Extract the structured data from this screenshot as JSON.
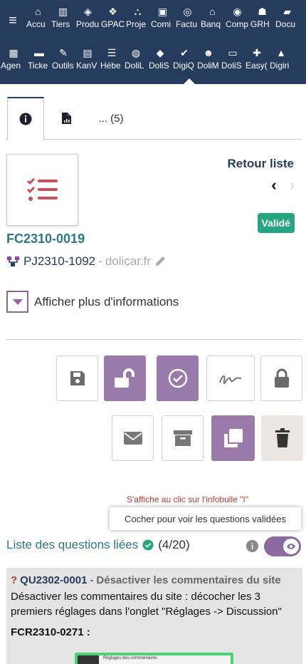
{
  "nav": {
    "row1": [
      {
        "icon": "home-icon",
        "glyph": "⌂",
        "label": "Accu"
      },
      {
        "icon": "building-icon",
        "glyph": "▥",
        "label": "Tiers"
      },
      {
        "icon": "cube-icon",
        "glyph": "◈",
        "label": "Produ"
      },
      {
        "icon": "cubes-icon",
        "glyph": "❖",
        "label": "GPAC"
      },
      {
        "icon": "project-icon",
        "glyph": "⛬",
        "label": "Proje"
      },
      {
        "icon": "briefcase-icon",
        "glyph": "▣",
        "label": "Comi"
      },
      {
        "icon": "coins-icon",
        "glyph": "◎",
        "label": "Factu"
      },
      {
        "icon": "bank-icon",
        "glyph": "⌂",
        "label": "Banq"
      },
      {
        "icon": "search-dollar-icon",
        "glyph": "◉",
        "label": "Comp"
      },
      {
        "icon": "user-tie-icon",
        "glyph": "☗",
        "label": "GRH"
      },
      {
        "icon": "folder-open-icon",
        "glyph": "▰",
        "label": "Docu"
      }
    ],
    "row2": [
      {
        "icon": "calendar-icon",
        "glyph": "▦",
        "label": "Agen"
      },
      {
        "icon": "ticket-icon",
        "glyph": "▬",
        "label": "Ticke"
      },
      {
        "icon": "wrench-icon",
        "glyph": "✎",
        "label": "Outils"
      },
      {
        "icon": "kanban-icon",
        "glyph": "▤",
        "label": "KanV"
      },
      {
        "icon": "server-icon",
        "glyph": "☰",
        "label": "Hébe"
      },
      {
        "icon": "dolil-icon",
        "glyph": "◍",
        "label": "DoliL"
      },
      {
        "icon": "lock-icon",
        "glyph": "◆",
        "label": "DoliS"
      },
      {
        "icon": "clipboard-check-icon",
        "glyph": "✔",
        "label": "DigiQ"
      },
      {
        "icon": "users-icon",
        "glyph": "☻",
        "label": "DoliM"
      },
      {
        "icon": "id-card-icon",
        "glyph": "▭",
        "label": "DoliS"
      },
      {
        "icon": "easy-icon",
        "glyph": "✚",
        "label": "Easy("
      },
      {
        "icon": "digiri-icon",
        "glyph": "▲",
        "label": "Digiri"
      }
    ]
  },
  "tabs": {
    "more_label": "... (5)"
  },
  "record": {
    "ref": "FC2310-0019",
    "project_ref": "PJ2310-1092",
    "project_separator": " - ",
    "project_site": "dolicar.fr",
    "back_label": "Retour liste",
    "prev_glyph": "‹",
    "next_glyph": "›",
    "status": "Validé",
    "more_info": "Afficher plus d'informations"
  },
  "tooltip": {
    "note": "S'affiche au clic sur l'infobulle \"I\"",
    "text": "Cocher pour voir les questions validées"
  },
  "questions": {
    "title": "Liste des questions liées",
    "count": "(4/20)",
    "info_glyph": "i",
    "item": {
      "code": "QU2302-0001",
      "sep": " - ",
      "label": "Désactiver les commentaires du site",
      "text": "Désactiver les commentaires du site : décocher les 3 premiers réglages dans l'onglet \"Réglages -> Discussion\"",
      "sub": "FCR2310-0271 :",
      "shot_title": "Réglages des commentaires"
    }
  },
  "colors": {
    "nav_bg": "#263c5c",
    "accent_purple": "#9a7aaa",
    "status_green": "#25a580",
    "link_teal": "#2a7a84",
    "note_red": "#c0392b"
  }
}
